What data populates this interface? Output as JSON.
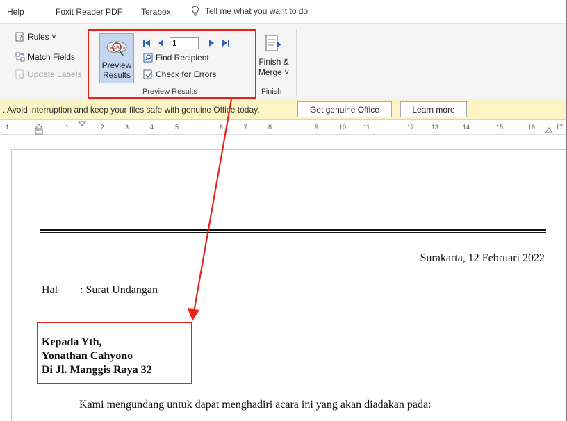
{
  "menu": {
    "items": [
      "Help",
      "Foxit Reader PDF",
      "Terabox"
    ],
    "tell_me": "Tell me what you want to do"
  },
  "ribbon": {
    "rules": "Rules ˅",
    "match_fields": "Match Fields",
    "update_labels": "Update Labels",
    "preview_results_line1": "Preview",
    "preview_results_line2": "Results",
    "record_value": "1",
    "find_recipient": "Find Recipient",
    "check_errors": "Check for Errors",
    "preview_group_label": "Preview Results",
    "finish_line1": "Finish &",
    "finish_line2": "Merge ˅",
    "finish_group_label": "Finish"
  },
  "message_bar": {
    "text": ". Avoid interruption and keep your files safe with genuine Office today.",
    "get_genuine": "Get genuine Office",
    "learn_more": "Learn more"
  },
  "ruler": {
    "ticks": [
      "1",
      "1",
      "2",
      "3",
      "4",
      "5",
      "6",
      "7",
      "8",
      "9",
      "10",
      "11",
      "12",
      "13",
      "14",
      "15",
      "16",
      "17"
    ]
  },
  "document": {
    "date": "Surakarta, 12 Februari 2022",
    "hal_label": "Hal",
    "hal_value": ": Surat Undangan",
    "address_line1": "Kepada Yth,",
    "address_line2": "Yonathan Cahyono",
    "address_line3": "Di Jl. Manggis Raya 32",
    "body_line": "Kami mengundang untuk dapat menghadiri acara ini yang akan diadakan pada:"
  },
  "colors": {
    "highlight_red": "#e8211b",
    "active_button": "#c5d7ee",
    "message_bar": "#fdf4c5"
  }
}
